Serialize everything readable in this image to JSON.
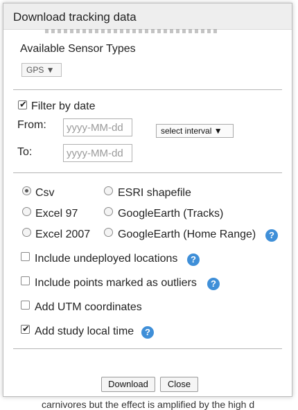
{
  "dialog": {
    "title": "Download tracking data"
  },
  "sensors": {
    "heading": "Available Sensor Types",
    "selected": "GPS ▼"
  },
  "date_filter": {
    "checkbox_label": "Filter by date",
    "checked": true,
    "from_label": "From:",
    "to_label": "To:",
    "from_placeholder": "yyyy-MM-dd",
    "to_placeholder": "yyyy-MM-dd",
    "interval_label": "select interval ▼"
  },
  "formats": [
    {
      "label": "Csv",
      "selected": true
    },
    {
      "label": "ESRI shapefile",
      "selected": false
    },
    {
      "label": "Excel 97",
      "selected": false
    },
    {
      "label": "GoogleEarth (Tracks)",
      "selected": false
    },
    {
      "label": "Excel 2007",
      "selected": false
    },
    {
      "label": "GoogleEarth (Home Range)",
      "selected": false,
      "help": true
    }
  ],
  "options": [
    {
      "label": "Include undeployed locations",
      "checked": false,
      "help": true
    },
    {
      "label": "Include points marked as outliers",
      "checked": false,
      "help": true
    },
    {
      "label": "Add UTM coordinates",
      "checked": false,
      "help": false
    },
    {
      "label": "Add study local time",
      "checked": true,
      "help": true
    }
  ],
  "buttons": {
    "download": "Download",
    "close": "Close"
  },
  "icons": {
    "help": "help-icon",
    "check": "checkmark-icon"
  },
  "colors": {
    "help_icon": "#3f8fd8",
    "title_bar": "#eeeeee"
  },
  "background_text": "carnivores but the effect is amplified by the high d"
}
